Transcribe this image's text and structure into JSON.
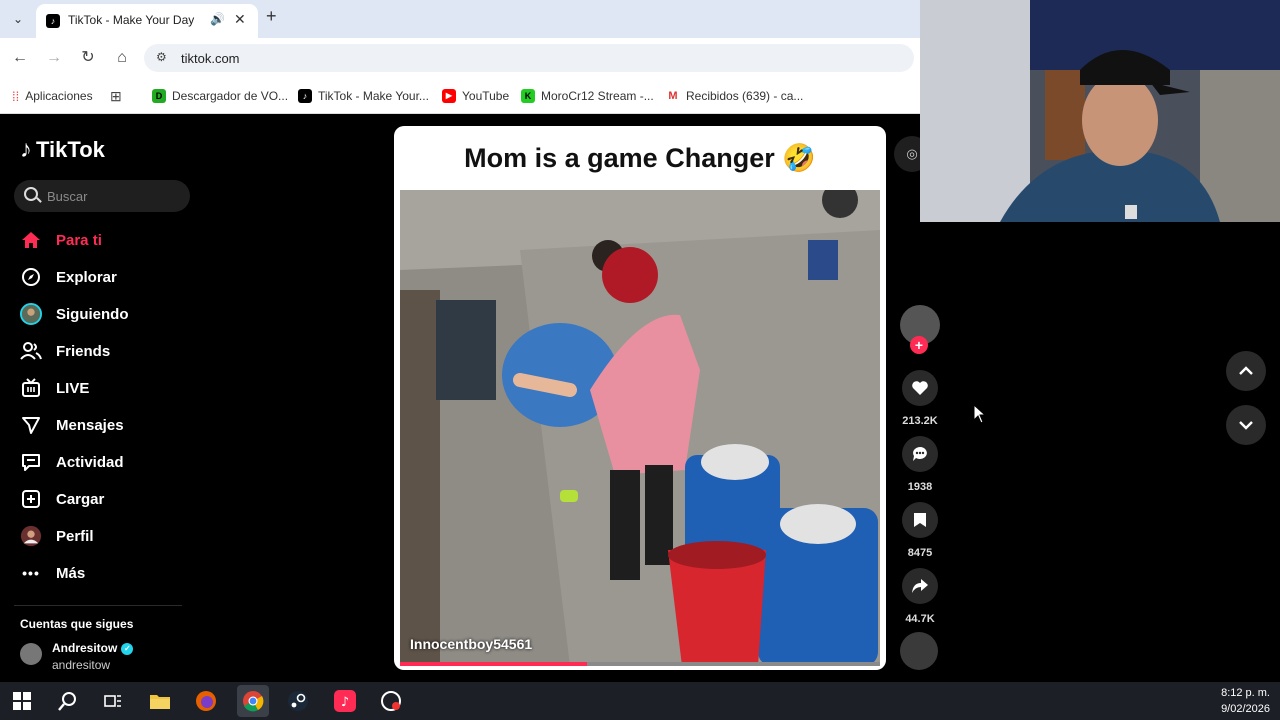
{
  "browser": {
    "tab_title": "TikTok - Make Your Day",
    "url": "tiktok.com",
    "bookmarks": [
      {
        "label": "Aplicaciones",
        "icon": "apps-grid-icon"
      },
      {
        "label": "Descargador de VO...",
        "icon": "downloader-icon"
      },
      {
        "label": "TikTok - Make Your...",
        "icon": "tiktok-icon"
      },
      {
        "label": "YouTube",
        "icon": "youtube-icon"
      },
      {
        "label": "MoroCr12 Stream -...",
        "icon": "kick-icon"
      },
      {
        "label": "Recibidos (639) - ca...",
        "icon": "gmail-icon"
      }
    ]
  },
  "tiktok": {
    "logo": "TikTok",
    "search_placeholder": "Buscar",
    "nav": [
      {
        "label": "Para ti",
        "icon": "home-icon",
        "active": true
      },
      {
        "label": "Explorar",
        "icon": "compass-icon"
      },
      {
        "label": "Siguiendo",
        "icon": "following-avatar-icon"
      },
      {
        "label": "Friends",
        "icon": "friends-icon"
      },
      {
        "label": "LIVE",
        "icon": "live-icon"
      },
      {
        "label": "Mensajes",
        "icon": "send-icon"
      },
      {
        "label": "Actividad",
        "icon": "activity-icon"
      },
      {
        "label": "Cargar",
        "icon": "upload-icon"
      },
      {
        "label": "Perfil",
        "icon": "profile-avatar-icon"
      },
      {
        "label": "Más",
        "icon": "more-icon"
      }
    ],
    "following_title": "Cuentas que sigues",
    "following_account": {
      "name": "Andresitow",
      "handle": "andresitow"
    }
  },
  "video": {
    "caption": "Mom is a game Changer 🤣",
    "author": "Innocentboy54561",
    "progress": 0.39,
    "likes": "213.2K",
    "comments": "1938",
    "saves": "8475",
    "shares": "44.7K"
  },
  "taskbar": {
    "time": "8:12 p. m.",
    "date": "9/02/2026"
  },
  "colors": {
    "accent": "#fe2c55",
    "background": "#000000"
  }
}
